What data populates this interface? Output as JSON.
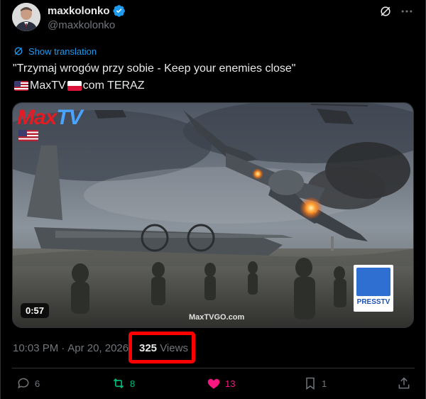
{
  "author": {
    "name": "maxkolonko",
    "handle": "@maxkolonko"
  },
  "post": {
    "translate_label": "Show translation",
    "text_line1": "\"Trzymaj  wrogów przy sobie - Keep your enemies close\"",
    "text_line2_part1": "MaxTV",
    "text_line2_part2": " com TERAZ"
  },
  "media": {
    "duration": "0:57",
    "logo_part1": "Max",
    "logo_part2": "TV",
    "press_label": "PRESSTV",
    "watermark": "MaxTVGO.com"
  },
  "meta": {
    "time": "10:03 PM",
    "separator": "·",
    "date": "Apr 20, 2026",
    "views_count": "325",
    "views_label": "Views"
  },
  "actions": {
    "replies": "6",
    "reposts": "8",
    "likes": "13",
    "bookmarks": "1"
  },
  "colors": {
    "accent": "#1d9bf0",
    "repost": "#00ba7c",
    "like": "#f91880",
    "highlight_box": "#ff0000"
  }
}
